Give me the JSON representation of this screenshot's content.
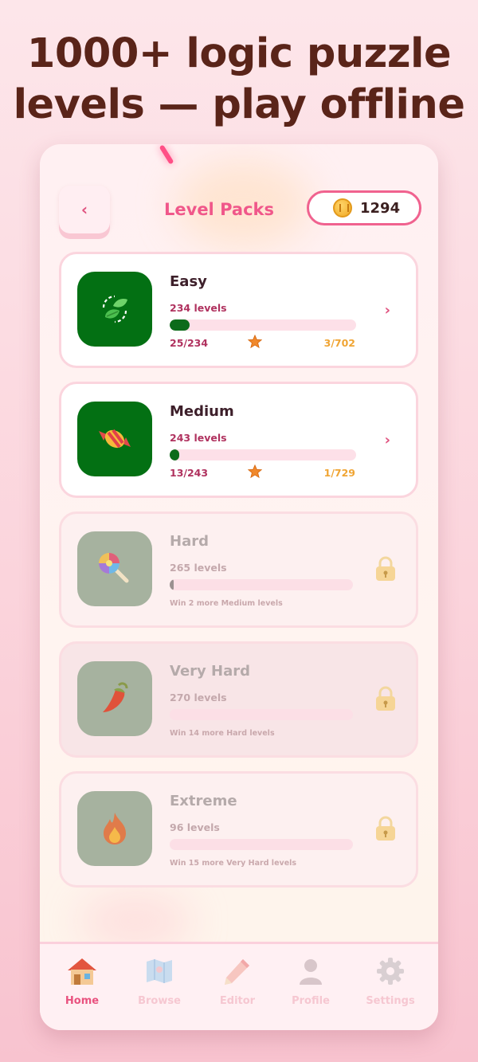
{
  "headline": {
    "line1": "1000+ logic puzzle",
    "line2": "levels — play offline"
  },
  "header": {
    "back_icon": "chevron-left-icon",
    "title": "Level Packs",
    "coin_icon": "coin-icon",
    "coins": "1294"
  },
  "packs": [
    {
      "name": "Easy",
      "levels_label": "234 levels",
      "icon": "leaf-icon",
      "locked": false,
      "progress": 0.107,
      "progress_text": "25/234",
      "stars_text": "3/702"
    },
    {
      "name": "Medium",
      "levels_label": "243 levels",
      "icon": "candy-icon",
      "locked": false,
      "progress": 0.053,
      "progress_text": "13/243",
      "stars_text": "1/729"
    },
    {
      "name": "Hard",
      "levels_label": "265 levels",
      "icon": "lollipop-icon",
      "locked": true,
      "progress": 0.004,
      "unlock_text": "Win 2 more Medium levels"
    },
    {
      "name": "Very Hard",
      "levels_label": "270 levels",
      "icon": "chili-pepper-icon",
      "locked": true,
      "progress": 0,
      "unlock_text": "Win 14 more Hard levels"
    },
    {
      "name": "Extreme",
      "levels_label": "96 levels",
      "icon": "fire-icon",
      "locked": true,
      "progress": 0,
      "unlock_text": "Win 15 more Very Hard levels"
    }
  ],
  "tabs": [
    {
      "label": "Home",
      "icon": "home-icon",
      "active": true
    },
    {
      "label": "Browse",
      "icon": "map-icon",
      "active": false
    },
    {
      "label": "Editor",
      "icon": "pencil-icon",
      "active": false
    },
    {
      "label": "Profile",
      "icon": "person-icon",
      "active": false
    },
    {
      "label": "Settings",
      "icon": "gear-icon",
      "active": false
    }
  ],
  "colors": {
    "accent": "#f0578a",
    "headline": "#5a2419",
    "pack_icon_bg": "#037013",
    "locked_icon_bg": "#a6b29f",
    "progress_fill": "#0c6b1a",
    "stars": "#f0a534"
  }
}
